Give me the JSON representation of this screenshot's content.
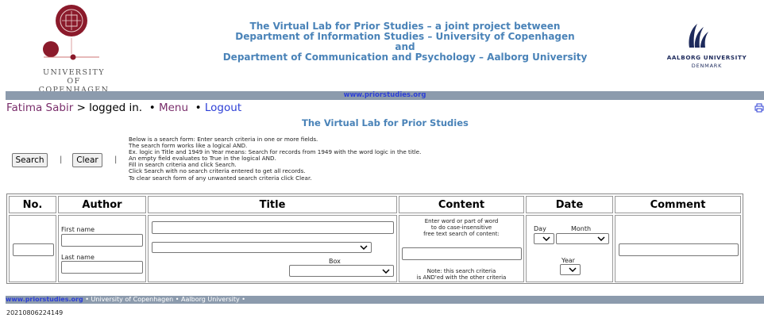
{
  "header": {
    "university_left": [
      "UNIVERSITY OF",
      "COPENHAGEN"
    ],
    "title_lines": [
      "The Virtual Lab for Prior Studies – a joint project between",
      "Department of Information  Studies – University of Copenhagen",
      "and",
      "Department of Communication and Psychology – Aalborg University"
    ],
    "university_right": "AALBORG UNIVERSITY",
    "university_right_sub": "DENMARK",
    "url_bar": "www.priorstudies.org"
  },
  "user_bar": {
    "user_name": "Fatima Sabir",
    "status": " > logged in.",
    "bullet": "•",
    "menu_label": "Menu",
    "logout_label": "Logout"
  },
  "page_title": "The Virtual Lab for Prior Studies",
  "controls": {
    "search_label": "Search",
    "clear_label": "Clear",
    "separator": "|"
  },
  "instructions": [
    "Below is a search form: Enter search criteria in one or more fields.",
    "The search form works like a logical AND.",
    "Ex. logic in Title and 1949 in Year means: Search for records from 1949 with the word logic in the title.",
    "An empty field evaluates to True in the logical AND.",
    "Fill in search criteria and click Search.",
    "Click Search with no search criteria entered to get all records.",
    "To clear search form of any unwanted search criteria click Clear."
  ],
  "table": {
    "headers": {
      "no": "No.",
      "author": "Author",
      "title": "Title",
      "content": "Content",
      "date": "Date",
      "comment": "Comment"
    },
    "author": {
      "first_name_label": "First name",
      "last_name_label": "Last name"
    },
    "title": {
      "box_label": "Box"
    },
    "content": {
      "help_lines": [
        "Enter word or part of word",
        "to do case-insensitive",
        "free text search of content:"
      ],
      "note_lines": [
        "Note: this search criteria",
        "is AND'ed with the other criteria"
      ]
    },
    "date": {
      "day_label": "Day",
      "month_label": "Month",
      "year_label": "Year"
    }
  },
  "footer": {
    "link": "www.priorstudies.org",
    "items": " • University of Copenhagen • Aalborg University •",
    "timestamp": "20210806224149"
  },
  "colors": {
    "header_blue": "#4a83b8",
    "bar_gray": "#8c9bad",
    "link_blue": "#2d3fd6",
    "user_purple": "#7a2e6b",
    "ucph_red": "#8b1a2b"
  }
}
